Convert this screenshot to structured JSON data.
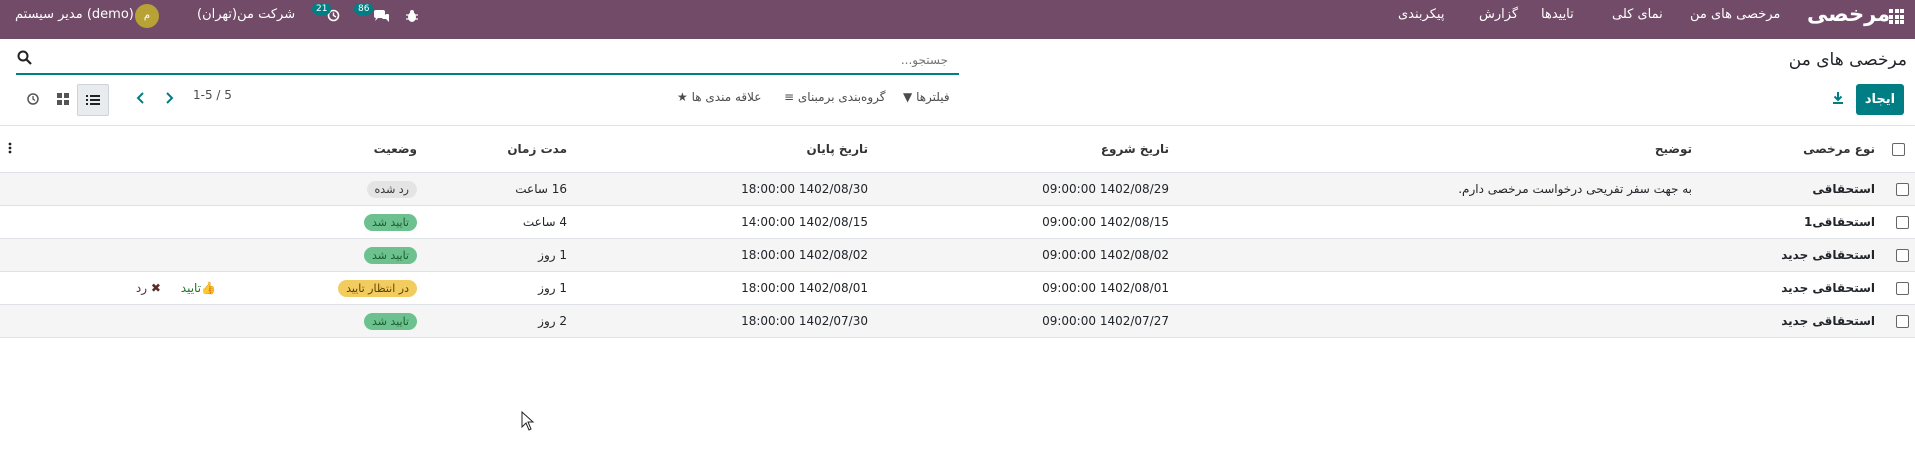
{
  "navbar": {
    "brand": "مرخصی",
    "menu": [
      "مرخصی های من",
      "نمای کلی",
      "تاییدها",
      "گزارش",
      "پیکربندی"
    ],
    "company": "شرکت من(تهران)",
    "user": "مدیر سیستم (demo)",
    "avatar_letter": "م",
    "chat_count": "86",
    "activity_count": "21"
  },
  "control_panel": {
    "title": "مرخصی های من",
    "create_label": "ایجاد",
    "search_placeholder": "جستجو...",
    "filters_label": "فیلترها",
    "groupby_label": "گروه‌بندی برمبنای",
    "favorites_label": "علاقه مندی ها",
    "pager": "1-5 / 5"
  },
  "table": {
    "headers": {
      "type": "نوع مرخصی",
      "description": "توضیح",
      "start": "تاریخ شروع",
      "end": "تاریخ پایان",
      "duration": "مدت زمان",
      "status": "وضعیت"
    },
    "rows": [
      {
        "type": "استحقاقی",
        "description": "به جهت سفر تفریحی درخواست مرخصی دارم.",
        "start": "1402/08/29 09:00:00",
        "end": "1402/08/30 18:00:00",
        "duration": "16 ساعت",
        "status": "رد شده",
        "status_kind": "refused"
      },
      {
        "type": "استحقاقی1",
        "description": "",
        "start": "1402/08/15 09:00:00",
        "end": "1402/08/15 14:00:00",
        "duration": "4 ساعت",
        "status": "تایید شد",
        "status_kind": "approved"
      },
      {
        "type": "استحقاقی جدید",
        "description": "",
        "start": "1402/08/02 09:00:00",
        "end": "1402/08/02 18:00:00",
        "duration": "1 روز",
        "status": "تایید شد",
        "status_kind": "approved"
      },
      {
        "type": "استحقاقی جدید",
        "description": "",
        "start": "1402/08/01 09:00:00",
        "end": "1402/08/01 18:00:00",
        "duration": "1 روز",
        "status": "در انتظار تایید",
        "status_kind": "pending",
        "approve_label": "تایید",
        "refuse_label": "رد"
      },
      {
        "type": "استحقاقی جدید",
        "description": "",
        "start": "1402/07/27 09:00:00",
        "end": "1402/07/30 18:00:00",
        "duration": "2 روز",
        "status": "تایید شد",
        "status_kind": "approved"
      }
    ]
  }
}
